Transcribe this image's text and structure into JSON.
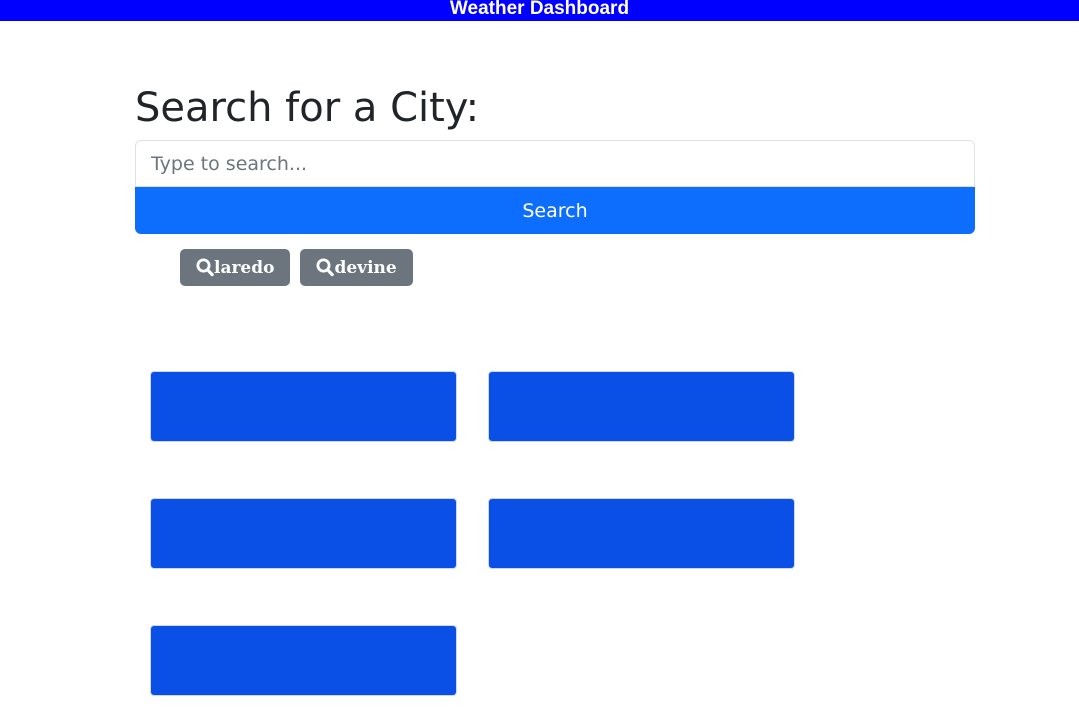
{
  "header": {
    "title": "Weather Dashboard"
  },
  "search": {
    "heading": "Search for a City:",
    "placeholder": "Type to search...",
    "value": "",
    "button_label": "Search"
  },
  "history": {
    "icon": "search-icon",
    "items": [
      {
        "label": "laredo"
      },
      {
        "label": "devine"
      }
    ]
  },
  "colors": {
    "header_bg": "#0000ff",
    "primary": "#0d6efd",
    "secondary": "#6c757d",
    "card_bg": "#0b50e6"
  },
  "forecast_cards": {
    "count": 5
  }
}
